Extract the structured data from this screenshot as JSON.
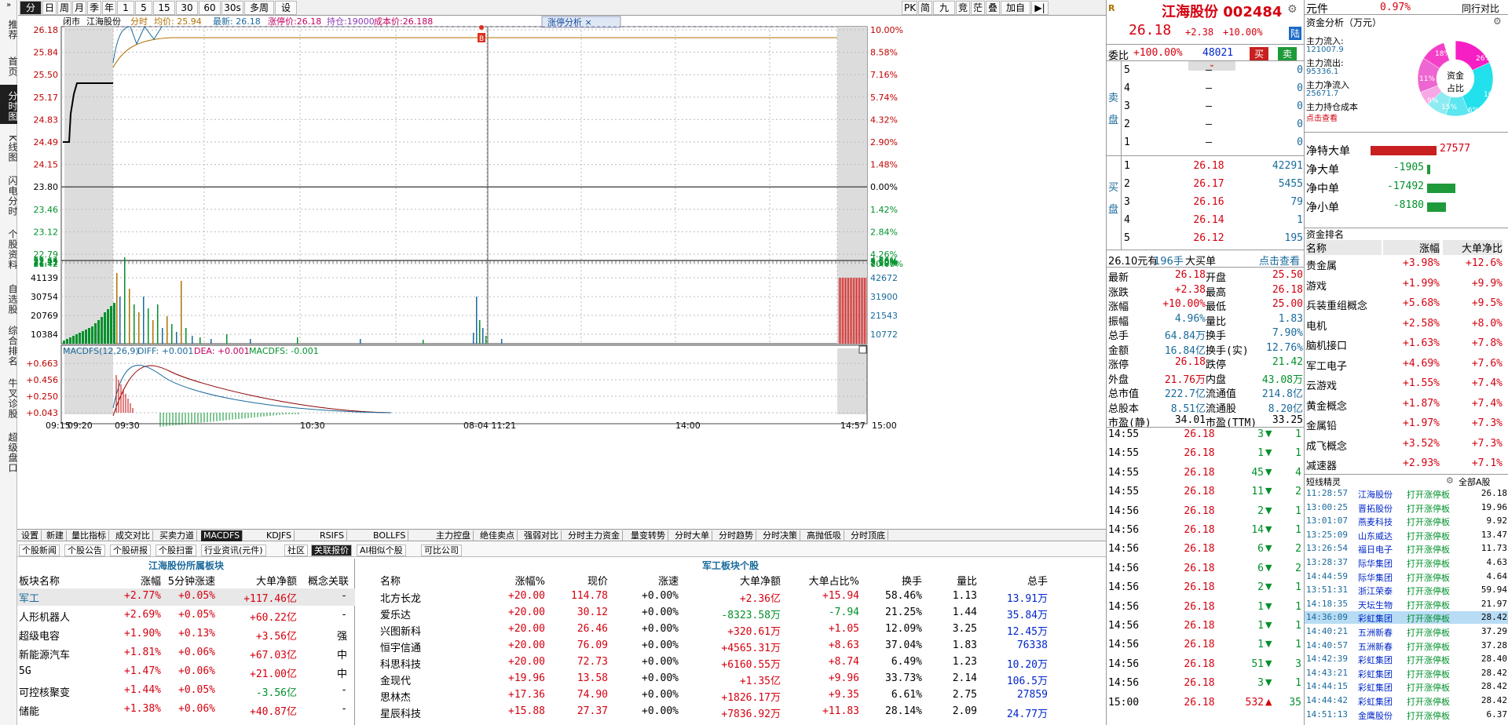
{
  "leftnav": [
    "推荐",
    "首页",
    "分时图",
    "K线图",
    "闪电分时",
    "个股资料",
    "自选股",
    "综合排名",
    "牛叉诊股",
    "超级盘口"
  ],
  "toolbar": {
    "left": [
      "分时",
      "日",
      "周",
      "月",
      "季",
      "年",
      "1分",
      "5分",
      "15分",
      "30分",
      "60分",
      "30s",
      "多周期",
      "设置"
    ],
    "right": [
      "PK",
      "简",
      "九转",
      "竞",
      "茫",
      "叠",
      "加自选"
    ]
  },
  "stock": {
    "name": "江海股份",
    "code": "002484",
    "price": "26.18",
    "change": "+2.38",
    "pct": "+10.00%",
    "tag": "陆"
  },
  "chart_info": {
    "status": "闭市",
    "name": "江海股份",
    "items": [
      "分时",
      "均价: 25.94",
      "最新: 26.18",
      "涨停价:26.18",
      "持仓:19000",
      "成本价:26.188"
    ],
    "zt_label": "涨停分析"
  },
  "chart_data": [
    {
      "type": "line",
      "title": "",
      "price_axis": [
        "26.18",
        "25.84",
        "25.50",
        "25.17",
        "24.83",
        "24.49",
        "24.15",
        "23.80",
        "23.46",
        "23.12",
        "22.79"
      ],
      "pct_axis": [
        "10.00%",
        "8.58%",
        "7.16%",
        "5.74%",
        "4.32%",
        "2.90%",
        "1.48%",
        "0.00%",
        "1.42%",
        "2.84%",
        "4.26%"
      ],
      "lower_price_axis": [
        "22.64",
        "22.45",
        "22.11",
        "21.77",
        "21.42"
      ],
      "lower_pct_axis": [
        "4.86%",
        "5.68%",
        "7.10%",
        "8.52%",
        "10.00%"
      ],
      "time_labels": [
        "09:15",
        "09:20",
        "09:30",
        "10:30",
        "08-04 11:21",
        "14:00",
        "14:57",
        "15:00"
      ]
    },
    {
      "type": "bar",
      "title": "",
      "vol_left": [
        "41139",
        "30754",
        "20769",
        "10384"
      ],
      "vol_right": [
        "42672",
        "31900",
        "21543",
        "10772"
      ]
    },
    {
      "type": "line",
      "title": "MACDFS(12,26,9)",
      "macd_axis": [
        "+0.663",
        "+0.456",
        "+0.250",
        "+0.043"
      ],
      "legend": [
        "MACDFS(12,26,9)",
        "DIFF: +0.001",
        "DEA: +0.001",
        "MACDFS: -0.001"
      ]
    }
  ],
  "bottom_tabs": [
    "设置",
    "新建",
    "量比指标",
    "成交对比",
    "买卖力道",
    "MACDFS",
    "KDJFS",
    "RSIFS",
    "BOLLFS",
    "主力控盘",
    "绝佳卖点",
    "强弱对比",
    "分时主力资金",
    "量变转势",
    "分时大单",
    "分时趋势",
    "分时决策",
    "高抛低吸",
    "分时顶底"
  ],
  "info_tabs": [
    "个股新闻",
    "个股公告",
    "个股研报",
    "个股扫雷",
    "行业资讯(元件)",
    "社区",
    "关联报价",
    "AI相似个股",
    "可比公司"
  ],
  "sector_table": {
    "title": "江海股份所属板块",
    "headers": [
      "板块名称",
      "涨幅",
      "5分钟涨速",
      "大单净额",
      "概念关联"
    ],
    "rows": [
      [
        "军工",
        "+2.77%",
        "+0.05%",
        "+117.46亿",
        "-"
      ],
      [
        "人形机器人",
        "+2.69%",
        "+0.05%",
        "+60.22亿",
        "-"
      ],
      [
        "超级电容",
        "+1.90%",
        "+0.13%",
        "+3.56亿",
        "强"
      ],
      [
        "新能源汽车",
        "+1.81%",
        "+0.06%",
        "+67.03亿",
        "中"
      ],
      [
        "5G",
        "+1.47%",
        "+0.06%",
        "+21.00亿",
        "中"
      ],
      [
        "可控核聚变",
        "+1.44%",
        "+0.05%",
        "-3.56亿",
        "-"
      ],
      [
        "储能",
        "+1.38%",
        "+0.06%",
        "+40.87亿",
        "-"
      ]
    ]
  },
  "stock_table": {
    "title": "军工板块个股",
    "headers": [
      "名称",
      "涨幅%",
      "现价",
      "涨速",
      "大单净额",
      "大单占比%",
      "换手",
      "量比",
      "总手"
    ],
    "rows": [
      [
        "北方长龙",
        "+20.00",
        "114.78",
        "+0.00%",
        "+2.36亿",
        "+15.94",
        "58.46%",
        "1.13",
        "13.91万"
      ],
      [
        "爱乐达",
        "+20.00",
        "30.12",
        "+0.00%",
        "-8323.58万",
        "-7.94",
        "21.25%",
        "1.44",
        "35.84万"
      ],
      [
        "兴图新科",
        "+20.00",
        "26.46",
        "+0.00%",
        "+320.61万",
        "+1.05",
        "12.09%",
        "3.25",
        "12.45万"
      ],
      [
        "恒宇信通",
        "+20.00",
        "76.09",
        "+0.00%",
        "+4565.31万",
        "+8.63",
        "37.04%",
        "1.83",
        "76338"
      ],
      [
        "科思科技",
        "+20.00",
        "72.73",
        "+0.00%",
        "+6160.55万",
        "+8.74",
        "6.49%",
        "1.23",
        "10.20万"
      ],
      [
        "金现代",
        "+19.96",
        "13.58",
        "+0.00%",
        "+1.35亿",
        "+9.96",
        "33.73%",
        "2.14",
        "106.5万"
      ],
      [
        "思林杰",
        "+17.36",
        "74.90",
        "+0.00%",
        "+1826.17万",
        "+9.35",
        "6.61%",
        "2.75",
        "27859"
      ],
      [
        "星辰科技",
        "+15.88",
        "27.37",
        "+0.00%",
        "+7836.92万",
        "+11.83",
        "28.14%",
        "2.09",
        "24.77万"
      ]
    ]
  },
  "order": {
    "wb_label": "委比",
    "wb": "+100.00%",
    "wb_num": "48021",
    "buy_btn": "买",
    "sell_btn": "卖",
    "sell_side": "卖盘",
    "buy_side": "买盘",
    "sells": [
      [
        "5",
        "–",
        "0"
      ],
      [
        "4",
        "–",
        "0"
      ],
      [
        "3",
        "–",
        "0"
      ],
      [
        "2",
        "–",
        "0"
      ],
      [
        "1",
        "–",
        "0"
      ]
    ],
    "buys": [
      [
        "1",
        "26.18",
        "42291"
      ],
      [
        "2",
        "26.17",
        "5455"
      ],
      [
        "3",
        "26.16",
        "79"
      ],
      [
        "4",
        "26.14",
        "1"
      ],
      [
        "5",
        "26.12",
        "195"
      ]
    ],
    "bigbuy": [
      "26.10元有",
      "196手",
      "大买单",
      "点击查看"
    ]
  },
  "quote": [
    [
      "最新",
      "26.18",
      "开盘",
      "25.50"
    ],
    [
      "涨跌",
      "+2.38",
      "最高",
      "26.18"
    ],
    [
      "涨幅",
      "+10.00%",
      "最低",
      "25.00"
    ],
    [
      "振幅",
      "4.96%",
      "量比",
      "1.83"
    ],
    [
      "总手",
      "64.84万",
      "换手",
      "7.90%"
    ],
    [
      "金额",
      "16.84亿",
      "换手(实)",
      "12.76%"
    ],
    [
      "涨停",
      "26.18",
      "跌停",
      "21.42"
    ],
    [
      "外盘",
      "21.76万",
      "内盘",
      "43.08万"
    ],
    [
      "总市值",
      "222.7亿",
      "流通值",
      "214.8亿"
    ],
    [
      "总股本",
      "8.51亿",
      "流通股",
      "8.20亿"
    ],
    [
      "市盈(静)",
      "34.01",
      "市盈(TTM)",
      "33.25"
    ]
  ],
  "ticks": [
    [
      "14:55",
      "26.18",
      "3"
    ],
    [
      "14:55",
      "26.18",
      "1"
    ],
    [
      "14:55",
      "26.18",
      "45"
    ],
    [
      "14:55",
      "26.18",
      "11"
    ],
    [
      "14:56",
      "26.18",
      "2"
    ],
    [
      "14:56",
      "26.18",
      "14"
    ],
    [
      "14:56",
      "26.18",
      "6"
    ],
    [
      "14:56",
      "26.18",
      "6"
    ],
    [
      "14:56",
      "26.18",
      "2"
    ],
    [
      "14:56",
      "26.18",
      "1"
    ],
    [
      "14:56",
      "26.18",
      "1"
    ],
    [
      "14:56",
      "26.18",
      "1"
    ],
    [
      "14:56",
      "26.18",
      "51"
    ],
    [
      "14:56",
      "26.18",
      "3"
    ],
    [
      "15:00",
      "26.18",
      "532"
    ]
  ],
  "tick_right": [
    "1",
    "1",
    "4",
    "2",
    "1",
    "1",
    "2",
    "2",
    "1",
    "1",
    "1",
    "1",
    "3",
    "1",
    "35"
  ],
  "fund": {
    "industry": "元件",
    "industry_pct": "0.97%",
    "peer": "同行对比",
    "title": "资金分析（万元）",
    "lines": [
      "主力流入:",
      "121007.9",
      "主力流出:",
      "95336.1",
      "主力净流入",
      "25671.7",
      "主力持仓成本",
      "点击查看"
    ],
    "donut": "资金占比",
    "donut_vals": [
      "18%",
      "26%",
      "11%",
      "10%",
      "15%",
      "9%",
      "6%"
    ],
    "nets": [
      [
        "净特大单",
        "27577"
      ],
      [
        "净大单",
        "-1905"
      ],
      [
        "净中单",
        "-17492"
      ],
      [
        "净小单",
        "-8180"
      ]
    ]
  },
  "rank": {
    "title": "资金排名",
    "headers": [
      "名称",
      "涨幅",
      "大单净比"
    ],
    "rows": [
      [
        "贵金属",
        "+3.98%",
        "+12.6%"
      ],
      [
        "游戏",
        "+1.99%",
        "+9.9%"
      ],
      [
        "兵装重组概念",
        "+5.68%",
        "+9.5%"
      ],
      [
        "电机",
        "+2.58%",
        "+8.0%"
      ],
      [
        "脑机接口",
        "+1.63%",
        "+7.8%"
      ],
      [
        "军工电子",
        "+4.69%",
        "+7.6%"
      ],
      [
        "云游戏",
        "+1.55%",
        "+7.4%"
      ],
      [
        "黄金概念",
        "+1.87%",
        "+7.4%"
      ],
      [
        "金属铅",
        "+1.97%",
        "+7.3%"
      ],
      [
        "成飞概念",
        "+3.52%",
        "+7.3%"
      ],
      [
        "减速器",
        "+2.93%",
        "+7.1%"
      ]
    ]
  },
  "short": {
    "title": "短线精灵",
    "scope": "全部A股",
    "rows": [
      [
        "11:28:57",
        "江海股份",
        "打开涨停板",
        "26.18"
      ],
      [
        "13:00:25",
        "晋拓股份",
        "打开涨停板",
        "19.96"
      ],
      [
        "13:01:07",
        "燕麦科技",
        "打开涨停板",
        "9.92"
      ],
      [
        "13:25:09",
        "山东威达",
        "打开涨停板",
        "13.47"
      ],
      [
        "13:26:54",
        "福日电子",
        "打开涨停板",
        "11.73"
      ],
      [
        "13:28:37",
        "际华集团",
        "打开涨停板",
        "4.63"
      ],
      [
        "14:44:59",
        "际华集团",
        "打开涨停板",
        "4.64"
      ],
      [
        "13:51:31",
        "浙江荣泰",
        "打开涨停板",
        "59.94"
      ],
      [
        "14:18:35",
        "天坛生物",
        "打开涨停板",
        "21.97"
      ],
      [
        "14:36:09",
        "彩虹集团",
        "打开涨停板",
        "28.42"
      ],
      [
        "14:40:21",
        "五洲新春",
        "打开涨停板",
        "37.29"
      ],
      [
        "14:40:57",
        "五洲新春",
        "打开涨停板",
        "37.28"
      ],
      [
        "14:42:39",
        "彩虹集团",
        "打开涨停板",
        "28.40"
      ],
      [
        "14:43:21",
        "彩虹集团",
        "打开涨停板",
        "28.42"
      ],
      [
        "14:44:15",
        "彩虹集团",
        "打开涨停板",
        "28.42"
      ],
      [
        "14:44:42",
        "彩虹集团",
        "打开涨停板",
        "28.42"
      ],
      [
        "14:51:13",
        "金鹰股份",
        "打开涨停板",
        "6.37"
      ]
    ]
  }
}
